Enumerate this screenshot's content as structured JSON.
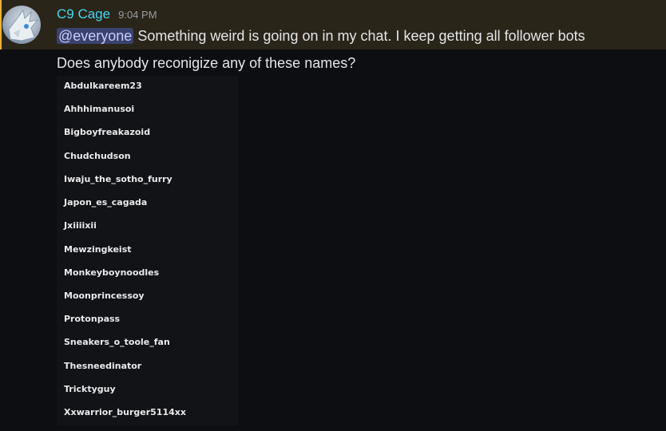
{
  "message": {
    "author": "C9 Cage",
    "timestamp": "9:04 PM",
    "mention": "@everyone",
    "line1_text": "Something weird is going on in my chat. I keep getting all follower bots",
    "line2_text": "Does anybody reconigize any of these names?"
  },
  "attachment": {
    "names": [
      "Abdulkareem23",
      "Ahhhimanusoi",
      "Bigboyfreakazoid",
      "Chudchudson",
      "Iwaju_the_sotho_furry",
      "Japon_es_cagada",
      "Jxiiiixii",
      "Mewzingkeist",
      "Monkeyboynoodles",
      "Moonprincessoy",
      "Protonpass",
      "Sneakers_o_toole_fan",
      "Thesneedinator",
      "Tricktyguy",
      "Xxwarrior_burger5114xx"
    ]
  },
  "colors": {
    "username": "#44d6f2",
    "mention_bg": "#3c4270",
    "highlight_bar": "#f0b232",
    "highlight_band": "#2a2519",
    "background": "#0d0e11"
  }
}
